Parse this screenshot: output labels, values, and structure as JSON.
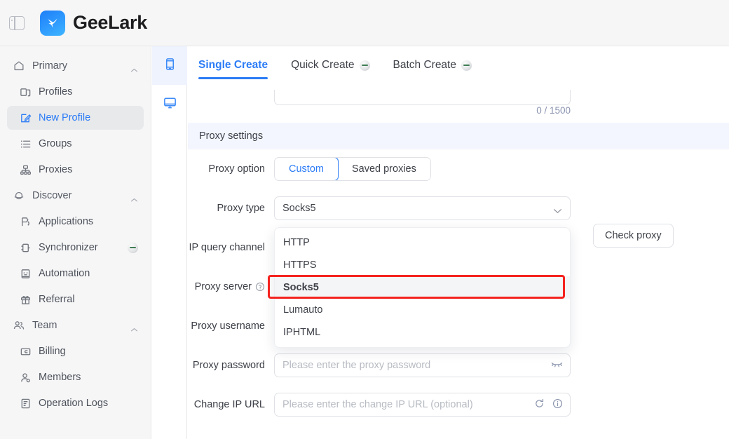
{
  "app": {
    "brand_name": "GeeLark",
    "panel_toggle_icon": "sidebar-toggle-icon",
    "logo_icon": "geelark-logo-icon",
    "accent_color": "#2b7cf6",
    "highlight_color": "#f5231f"
  },
  "sidebar": {
    "groups": [
      {
        "label": "Primary",
        "icon": "home-icon",
        "expanded": true,
        "items": [
          {
            "label": "Profiles",
            "icon": "profiles-icon",
            "active": false,
            "badge": false
          },
          {
            "label": "New Profile",
            "icon": "new-profile-icon",
            "active": true,
            "badge": false
          },
          {
            "label": "Groups",
            "icon": "groups-icon",
            "active": false,
            "badge": false
          },
          {
            "label": "Proxies",
            "icon": "proxies-icon",
            "active": false,
            "badge": false
          }
        ]
      },
      {
        "label": "Discover",
        "icon": "discover-icon",
        "expanded": true,
        "items": [
          {
            "label": "Applications",
            "icon": "applications-icon",
            "active": false,
            "badge": false
          },
          {
            "label": "Synchronizer",
            "icon": "synchronizer-icon",
            "active": false,
            "badge": true
          },
          {
            "label": "Automation",
            "icon": "automation-icon",
            "active": false,
            "badge": false
          },
          {
            "label": "Referral",
            "icon": "referral-icon",
            "active": false,
            "badge": false
          }
        ]
      },
      {
        "label": "Team",
        "icon": "team-icon",
        "expanded": true,
        "items": [
          {
            "label": "Billing",
            "icon": "billing-icon",
            "active": false,
            "badge": false
          },
          {
            "label": "Members",
            "icon": "members-icon",
            "active": false,
            "badge": false
          },
          {
            "label": "Operation Logs",
            "icon": "operation-logs-icon",
            "active": false,
            "badge": false
          }
        ]
      }
    ]
  },
  "rail": {
    "items": [
      {
        "icon": "mobile-phone-icon",
        "active": true
      },
      {
        "icon": "desktop-monitor-icon",
        "active": false
      }
    ]
  },
  "main": {
    "tabs": [
      {
        "label": "Single Create",
        "active": true,
        "badge": false
      },
      {
        "label": "Quick Create",
        "active": false,
        "badge": true
      },
      {
        "label": "Batch Create",
        "active": false,
        "badge": true
      }
    ],
    "remark_counter": "0 / 1500",
    "section_title": "Proxy settings",
    "proxy_option": {
      "label": "Proxy option",
      "options": [
        {
          "label": "Custom",
          "active": true
        },
        {
          "label": "Saved proxies",
          "active": false
        }
      ]
    },
    "proxy_type": {
      "label": "Proxy type",
      "value": "Socks5",
      "chevron_icon": "chevron-down-icon",
      "open": true,
      "options": [
        {
          "label": "HTTP",
          "selected": false
        },
        {
          "label": "HTTPS",
          "selected": false
        },
        {
          "label": "Socks5",
          "selected": true
        },
        {
          "label": "Lumauto",
          "selected": false
        },
        {
          "label": "IPHTML",
          "selected": false
        }
      ]
    },
    "ip_query_channel": {
      "label": "IP query channel"
    },
    "proxy_server": {
      "label": "Proxy server",
      "help_icon": "help-circle-icon"
    },
    "proxy_username": {
      "label": "Proxy username"
    },
    "proxy_password": {
      "label": "Proxy password",
      "placeholder": "Please enter the proxy password",
      "value": "",
      "suffix_icon": "eye-closed-icon"
    },
    "change_ip_url": {
      "label": "Change IP URL",
      "placeholder": "Please enter the change IP URL (optional)",
      "value": "",
      "refresh_icon": "refresh-icon",
      "info_icon": "info-circle-icon"
    },
    "check_proxy_button": "Check proxy"
  }
}
